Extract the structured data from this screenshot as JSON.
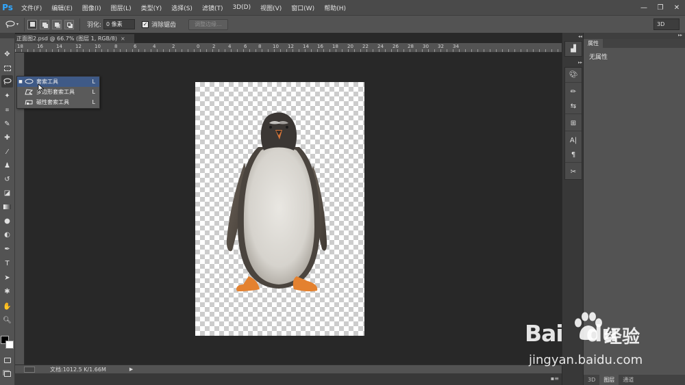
{
  "app": {
    "logo": "Ps"
  },
  "menu": [
    "文件(F)",
    "编辑(E)",
    "图像(I)",
    "图层(L)",
    "类型(Y)",
    "选择(S)",
    "滤镜(T)",
    "3D(D)",
    "视图(V)",
    "窗口(W)",
    "帮助(H)"
  ],
  "window_controls": {
    "minimize": "—",
    "maximize": "❐",
    "close": "✕"
  },
  "options": {
    "feather_label": "羽化:",
    "feather_value": "0 像素",
    "antialias_label": "消除锯齿",
    "antialias_checked": true,
    "refine_edge_label": "调整边缘...",
    "workspace": "3D"
  },
  "document": {
    "tab_title": "正面图2.psd @ 66.7% (图层 1, RGB/8)",
    "close": "×"
  },
  "ruler": {
    "h_labels": [
      "18",
      "16",
      "14",
      "12",
      "10",
      "8",
      "6",
      "4",
      "2",
      "0",
      "2",
      "4",
      "6",
      "8",
      "10",
      "12",
      "14",
      "16",
      "18",
      "20",
      "22",
      "24",
      "26",
      "28",
      "30",
      "32",
      "34"
    ]
  },
  "flyout": {
    "items": [
      {
        "label": "套索工具",
        "key": "L",
        "selected": true,
        "icon": "lasso-icon"
      },
      {
        "label": "多边形套索工具",
        "key": "L",
        "selected": false,
        "icon": "polygonal-lasso-icon"
      },
      {
        "label": "磁性套索工具",
        "key": "L",
        "selected": false,
        "icon": "magnetic-lasso-icon"
      }
    ]
  },
  "status": {
    "zoom": "",
    "doc_info": "文档:1012.5 K/1.66M",
    "arrow": "▶"
  },
  "properties": {
    "tab": "属性",
    "text": "无属性"
  },
  "bottom_tabs": [
    "3D",
    "图层",
    "通道"
  ],
  "watermark": {
    "logo": "Bai",
    "logo_tail": "du",
    "cn": "经验",
    "url": "jingyan.baidu.com"
  },
  "colors": {
    "accent_selected": "#3f5a87",
    "ps_blue": "#31a8ff"
  }
}
